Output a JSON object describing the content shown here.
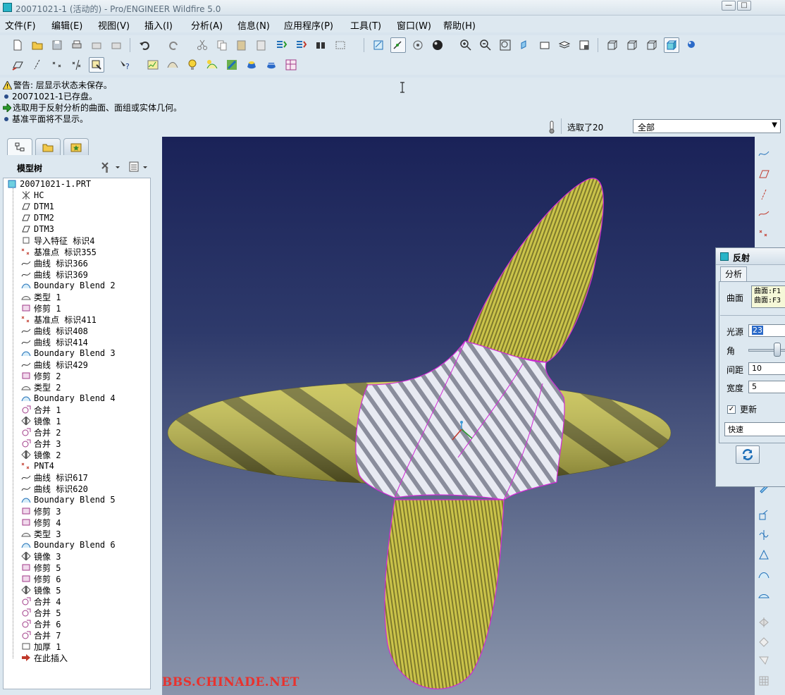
{
  "window": {
    "title": "20071021-1 (活动的) - Pro/ENGINEER Wildfire 5.0",
    "minimize_label": "—",
    "maximize_label": "□"
  },
  "menu": [
    "文件(F)",
    "编辑(E)",
    "视图(V)",
    "插入(I)",
    "分析(A)",
    "信息(N)",
    "应用程序(P)",
    "工具(T)",
    "窗口(W)",
    "帮助(H)"
  ],
  "messages": {
    "line1": "警告: 层显示状态未保存。",
    "line2": "20071021-1已存盘。",
    "line3": "选取用于反射分析的曲面、面组或实体几何。",
    "line4": "基准平面将不显示。"
  },
  "status": {
    "selected_text": "选取了20",
    "filter_value": "全部"
  },
  "tree": {
    "title": "模型树",
    "root": "20071021-1.PRT",
    "items": [
      {
        "label": "HC",
        "icon": "csys"
      },
      {
        "label": "DTM1",
        "icon": "plane"
      },
      {
        "label": "DTM2",
        "icon": "plane"
      },
      {
        "label": "DTM3",
        "icon": "plane"
      },
      {
        "label": "导入特征 标识4",
        "icon": "import"
      },
      {
        "label": "基准点 标识355",
        "icon": "point"
      },
      {
        "label": "曲线 标识366",
        "icon": "curve"
      },
      {
        "label": "曲线 标识369",
        "icon": "curve"
      },
      {
        "label": "Boundary Blend 2",
        "icon": "blend"
      },
      {
        "label": "类型 1",
        "icon": "type"
      },
      {
        "label": "修剪 1",
        "icon": "trim"
      },
      {
        "label": "基准点 标识411",
        "icon": "point"
      },
      {
        "label": "曲线 标识408",
        "icon": "curve"
      },
      {
        "label": "曲线 标识414",
        "icon": "curve"
      },
      {
        "label": "Boundary Blend 3",
        "icon": "blend"
      },
      {
        "label": "曲线 标识429",
        "icon": "curve"
      },
      {
        "label": "修剪 2",
        "icon": "trim"
      },
      {
        "label": "类型 2",
        "icon": "type"
      },
      {
        "label": "Boundary Blend 4",
        "icon": "blend"
      },
      {
        "label": "合并 1",
        "icon": "merge"
      },
      {
        "label": "镜像 1",
        "icon": "mirror"
      },
      {
        "label": "合并 2",
        "icon": "merge"
      },
      {
        "label": "合并 3",
        "icon": "merge"
      },
      {
        "label": "镜像 2",
        "icon": "mirror"
      },
      {
        "label": "PNT4",
        "icon": "point"
      },
      {
        "label": "曲线 标识617",
        "icon": "curve"
      },
      {
        "label": "曲线 标识620",
        "icon": "curve"
      },
      {
        "label": "Boundary Blend 5",
        "icon": "blend"
      },
      {
        "label": "修剪 3",
        "icon": "trim"
      },
      {
        "label": "修剪 4",
        "icon": "trim"
      },
      {
        "label": "类型 3",
        "icon": "type"
      },
      {
        "label": "Boundary Blend 6",
        "icon": "blend"
      },
      {
        "label": "镜像 3",
        "icon": "mirror"
      },
      {
        "label": "修剪 5",
        "icon": "trim"
      },
      {
        "label": "修剪 6",
        "icon": "trim"
      },
      {
        "label": "镜像 5",
        "icon": "mirror"
      },
      {
        "label": "合并 4",
        "icon": "merge"
      },
      {
        "label": "合并 5",
        "icon": "merge"
      },
      {
        "label": "合并 6",
        "icon": "merge"
      },
      {
        "label": "合并 7",
        "icon": "merge"
      },
      {
        "label": "加厚 1",
        "icon": "thicken"
      },
      {
        "label": "在此插入",
        "icon": "insert-arrow"
      }
    ]
  },
  "dialog": {
    "title": "反射",
    "tab": "分析",
    "surface_label": "曲面",
    "surface_items": [
      "曲面:F1",
      "曲面:F3"
    ],
    "light_label": "光源",
    "light_value": "23",
    "angle_label": "角",
    "spacing_label": "间距",
    "spacing_value": "10",
    "width_label": "宽度",
    "width_value": "5",
    "update_label": "更新",
    "update_checked": true,
    "mode_value": "快速"
  },
  "watermark": "BBS.CHINADE.NET",
  "colors": {
    "accent": "#27b4c8",
    "surface_yellow": "#b8b23a",
    "surface_white": "#e4e6ee",
    "edge_magenta": "#d02ad6"
  }
}
